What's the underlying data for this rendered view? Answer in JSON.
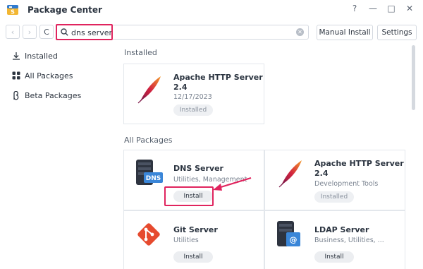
{
  "window": {
    "title": "Package Center"
  },
  "titlebar_controls": {
    "help": "?",
    "minimize": "—",
    "maximize": "□",
    "close": "✕"
  },
  "toolbar": {
    "back": "‹",
    "forward": "›",
    "refresh": "C",
    "search_value": "dns server",
    "manual_install": "Manual Install",
    "settings": "Settings"
  },
  "sidebar": {
    "items": [
      {
        "label": "Installed",
        "icon": "download-icon"
      },
      {
        "label": "All Packages",
        "icon": "grid-icon"
      },
      {
        "label": "Beta Packages",
        "icon": "beta-icon"
      }
    ]
  },
  "installed_section": {
    "title": "Installed",
    "cards": [
      {
        "name_line1": "Apache HTTP Server",
        "name_line2": "2.4",
        "sub": "12/17/2023",
        "button": "Installed",
        "icon": "apache-feather-icon"
      }
    ]
  },
  "all_packages_section": {
    "title": "All Packages",
    "cards": [
      {
        "name": "DNS Server",
        "sub": "Utilities, Management",
        "button": "Install",
        "icon": "dns-server-icon",
        "icon_label": "DNS"
      },
      {
        "name_line1": "Apache HTTP Server",
        "name_line2": "2.4",
        "sub": "Development Tools",
        "button": "Installed",
        "icon": "apache-feather-icon"
      },
      {
        "name": "Git Server",
        "sub": "Utilities",
        "button": "Install",
        "icon": "git-icon"
      },
      {
        "name": "LDAP Server",
        "sub": "Business, Utilities, ...",
        "button": "Install",
        "icon": "ldap-server-icon",
        "icon_label": "@"
      }
    ]
  },
  "colors": {
    "highlight": "#e0245e",
    "accent": "#2f6fd8"
  }
}
